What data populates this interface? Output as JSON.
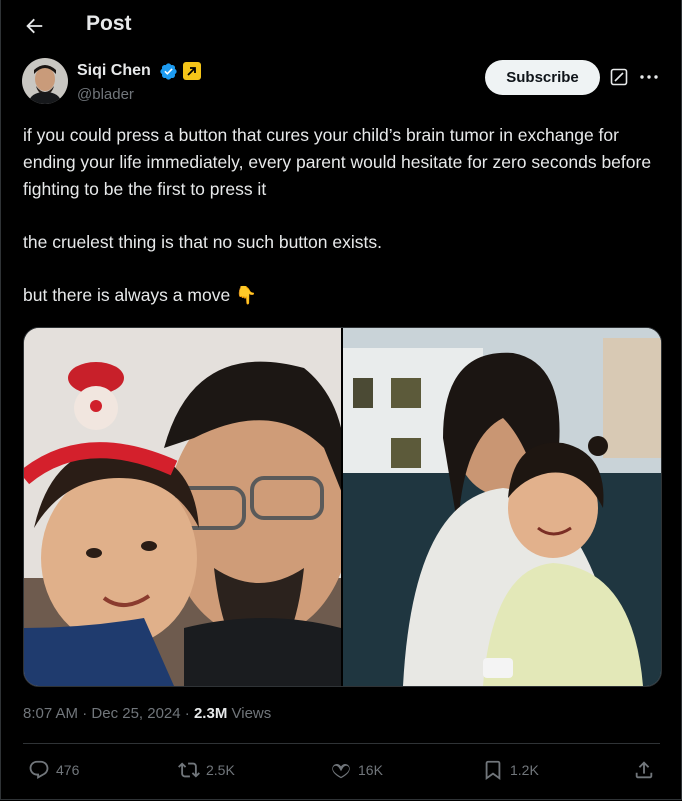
{
  "header": {
    "title": "Post",
    "back_icon": "arrow-left-icon"
  },
  "author": {
    "name": "Siqi Chen",
    "handle": "@blader",
    "verified_icon": "verified-badge-icon",
    "affiliation_icon": "affiliate-arrow-icon",
    "verified_color": "#1d9bf0",
    "affiliation_color": "#f5c518"
  },
  "actions_top": {
    "subscribe_label": "Subscribe",
    "grok_icon": "grok-icon",
    "more_icon": "more-dots-icon"
  },
  "tweet": {
    "paragraphs": [
      "if you could press a button that cures your child’s brain tumor in exchange for ending your life immediately, every parent would hesitate for zero seconds before fighting to be the first to press it",
      "the cruelest thing is that no such button exists.",
      "but there is always a move 👇"
    ]
  },
  "media": [
    {
      "name": "photo-father-daughter-selfie"
    },
    {
      "name": "photo-mother-daughter-hospital"
    }
  ],
  "meta": {
    "time": "8:07 AM",
    "date": "Dec 25, 2024",
    "views_count": "2.3M",
    "views_label": "Views",
    "sep": "·"
  },
  "engagement": {
    "replies": "476",
    "reposts": "2.5K",
    "likes": "16K",
    "bookmarks": "1.2K"
  },
  "colors": {
    "background": "#000000",
    "text": "#e7e9ea",
    "muted": "#71767b",
    "border": "#2f3336"
  }
}
